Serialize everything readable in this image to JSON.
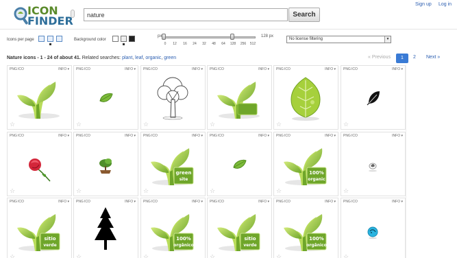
{
  "header": {
    "logo_line1": "ICON",
    "logo_line2": "FINDER",
    "search_value": "nature",
    "search_button": "Search",
    "signup": "Sign up",
    "login": "Log in"
  },
  "options": {
    "icons_per_page_label": "Icons per page",
    "background_color_label": "Background color",
    "px_label_left": "px",
    "px_label_right": "128 px",
    "size_ticks": [
      "0",
      "12",
      "16",
      "24",
      "32",
      "48",
      "64",
      "128",
      "256",
      "512"
    ],
    "license_filter": "No license filtering"
  },
  "results": {
    "summary_bold": "Nature icons - 1 - 24 of about 41.",
    "related_label": "Related searches:",
    "related": [
      "plant",
      "leaf",
      "organic",
      "green"
    ]
  },
  "pagination": {
    "previous": "« Previous",
    "current_page": "1",
    "next_page": "2",
    "next": "Next »"
  },
  "cell_labels": {
    "png": "PNG",
    "ico": "ICO",
    "info": "INFO ▾"
  },
  "icons": [
    {
      "name": "sprout-icon",
      "kind": "sprout"
    },
    {
      "name": "leaf-small-icon",
      "kind": "leaf-small"
    },
    {
      "name": "tree-sketch-icon",
      "kind": "tree-sketch"
    },
    {
      "name": "sprout-bar-icon",
      "kind": "sprout-bar"
    },
    {
      "name": "big-leaf-icon",
      "kind": "big-leaf"
    },
    {
      "name": "black-leaf-icon",
      "kind": "black-leaf"
    },
    {
      "name": "rose-icon",
      "kind": "rose"
    },
    {
      "name": "bonsai-icon",
      "kind": "bonsai"
    },
    {
      "name": "green-site-sprout-icon",
      "kind": "sprout-badge",
      "badge": [
        "green",
        "site"
      ]
    },
    {
      "name": "leaf-small-icon",
      "kind": "leaf-small"
    },
    {
      "name": "organic-sprout-icon",
      "kind": "sprout-badge",
      "badge": [
        "100%",
        "organic"
      ]
    },
    {
      "name": "feather-icon",
      "kind": "feather"
    },
    {
      "name": "sitio-verde-sprout-icon",
      "kind": "sprout-badge",
      "badge": [
        "sitio",
        "verde"
      ]
    },
    {
      "name": "pine-tree-icon",
      "kind": "pine"
    },
    {
      "name": "organico-sprout-icon",
      "kind": "sprout-badge",
      "badge": [
        "100%",
        "orgânico"
      ]
    },
    {
      "name": "sitio-verde-sprout-icon",
      "kind": "sprout-badge",
      "badge": [
        "sitio",
        "verde"
      ]
    },
    {
      "name": "organic-sprout-icon",
      "kind": "sprout-badge",
      "badge": [
        "100%",
        "orgânico"
      ]
    },
    {
      "name": "blue-badge-icon",
      "kind": "blue-badge"
    }
  ],
  "colors": {
    "leaf_light": "#b8dc5a",
    "leaf_dark": "#6fa62a",
    "link": "#2a5db0",
    "page_button": "#3a7bd5"
  }
}
